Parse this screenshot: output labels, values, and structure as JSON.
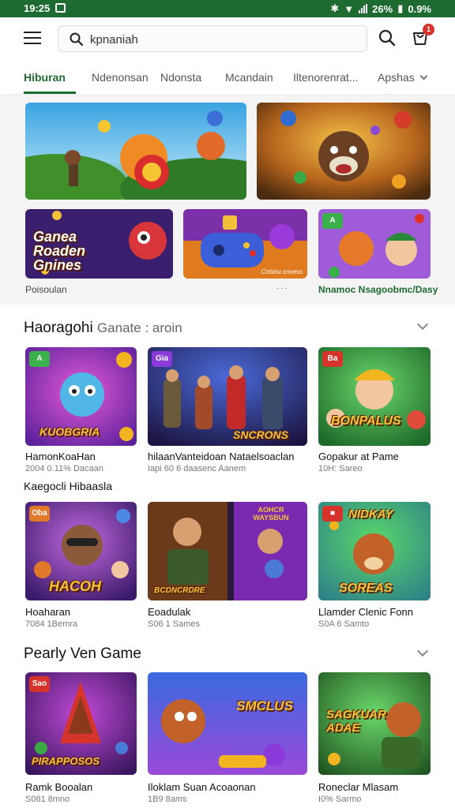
{
  "status_bar": {
    "time": "19:25",
    "battery": "26%",
    "signal": "0.9%"
  },
  "search": {
    "value": "kpnaniah"
  },
  "cart": {
    "badge": "1"
  },
  "tabs": [
    {
      "label": "Hiburan",
      "active": true
    },
    {
      "label": "Ndenonsan"
    },
    {
      "label": "Ndonsta"
    },
    {
      "label": "Mcandain"
    },
    {
      "label": "Iltenorenrat..."
    },
    {
      "label": "Apshas"
    }
  ],
  "banners": {
    "top": [
      {
        "name": "adventure-banner"
      },
      {
        "name": "hero-banner"
      }
    ],
    "bottom": [
      {
        "title": "Ganea Roaden Gnines"
      },
      {
        "caption": "Cnbinu cnvess"
      },
      {
        "corner": "A"
      }
    ],
    "caption_left": "Poisoulan",
    "caption_mid": "· · ·",
    "caption_right": "Nnamoc Nsagoobmc/Dasy"
  },
  "section1": {
    "title": "Haoragohi",
    "subtitle": "Ganate : aroin",
    "row1": [
      {
        "name": "HamonKoaHan",
        "meta": "2004 0.11% Dacaan",
        "art": "KUOBGRIA",
        "corner": "A"
      },
      {
        "name": "hilaanVanteidoan Nataelsoaclan",
        "meta": "Iapi 60 6 daasenc Aanem",
        "art": "SNCRONS",
        "corner": "Gia"
      },
      {
        "name": "Gopakur at Pame",
        "meta": "10H: Sareo",
        "art": "BONPALUS",
        "corner": "Ba"
      }
    ],
    "category": "Kaegocli Hibaasla",
    "row2": [
      {
        "name": "Hoaharan",
        "meta": "7084 1Bemra",
        "art": "HACOH",
        "corner": "Oba"
      },
      {
        "name": "Eoadulak",
        "meta": "S06 1 Sames",
        "art": "BCDNCRDRE",
        "corner2": "AOHCR WAYSBUN"
      },
      {
        "name": "Llamder Clenic Fonn",
        "meta": "S0A 6 Samto",
        "art": "SOREAS",
        "top": "NIDKAY"
      }
    ]
  },
  "section2": {
    "title": "Pearly Ven Game",
    "row": [
      {
        "name": "Ramk Booalan",
        "meta": "S081 8mno",
        "art": "PIRAPPOSOS",
        "corner": "Sao"
      },
      {
        "name": "Iloklam Suan Acoaonan",
        "meta": "1B9 8ams",
        "art": "SMCLUS"
      },
      {
        "name": "Roneclar Mlasam",
        "meta": "I0% Sarmo",
        "art": "SAGKUAR ADAE"
      }
    ]
  },
  "colors": {
    "accent": "#1e6b32",
    "badge": "#d6342a"
  }
}
